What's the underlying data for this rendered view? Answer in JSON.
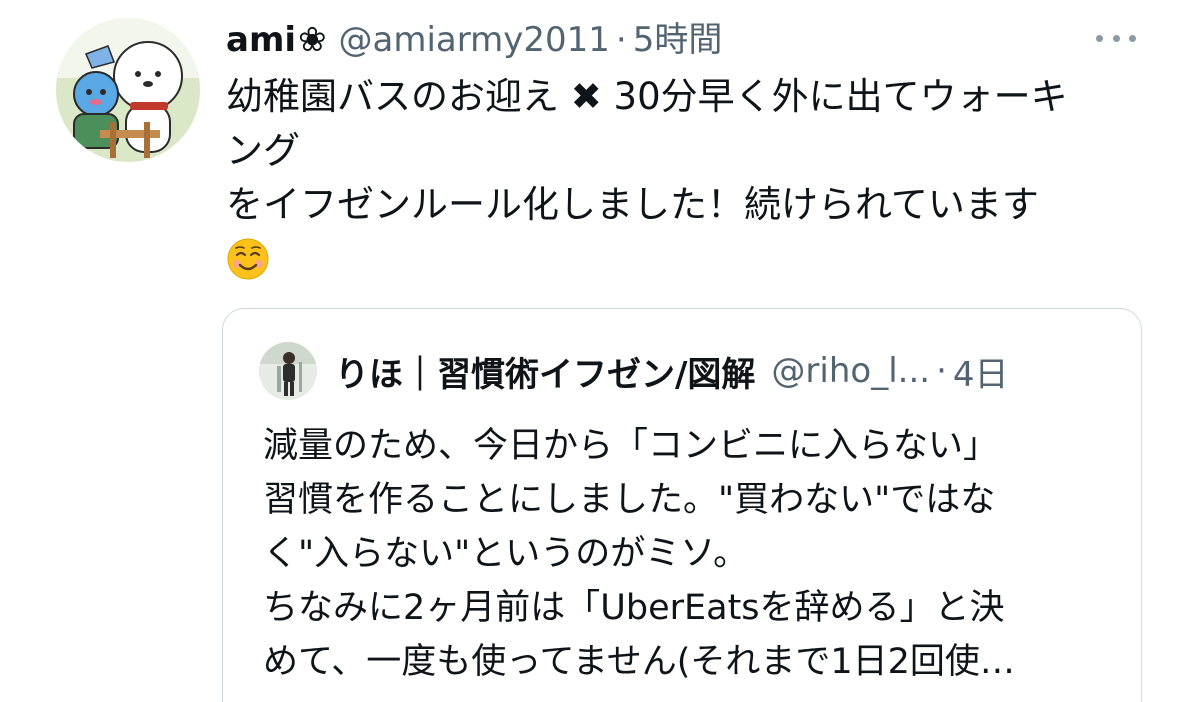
{
  "colors": {
    "text": "#0f1419",
    "secondary": "#536471",
    "border": "#cfd9de",
    "dots": "#8b98a5"
  },
  "tweet": {
    "avatar_icon": "cartoon-characters-avatar",
    "display_name": "ami",
    "name_glyph": "❀",
    "handle": "@amiarmy2011",
    "separator": "·",
    "time": "5時間",
    "more_icon": "more-dots-icon",
    "body": {
      "line1_prefix": "幼稚園バスのお迎え ",
      "line1_cross": "✖",
      "line1_suffix": " 30分早く外に出てウォーキ",
      "line2": "ング",
      "line3": "をイフゼンルール化しました！続けられています",
      "emoji_icon": "smiling-face-emoji"
    }
  },
  "quote": {
    "avatar_icon": "person-photo-avatar",
    "display_name": "りほ｜習慣術イフゼン/図解",
    "handle": "@riho_l...",
    "separator": "·",
    "time": "4日",
    "lines": [
      "減量のため、今日から「コンビニに入らない」",
      "習慣を作ることにしました。\"買わない\"ではな",
      "く\"入らない\"というのがミソ。",
      "ちなみに2ヶ月前は「UberEatsを辞める」と決",
      "めて、一度も使ってません(それまで1日2回使…"
    ]
  }
}
